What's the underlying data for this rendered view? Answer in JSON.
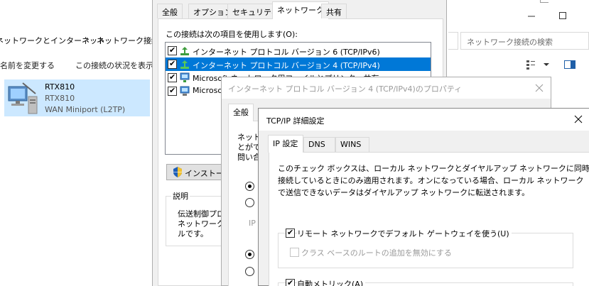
{
  "explorer": {
    "breadcrumb": [
      "ネットワークとインターネット",
      "ネットワーク接続"
    ],
    "search_placeholder": "ネットワーク接続の検索",
    "commands": [
      "名前を変更する",
      "この接続の状況を表示"
    ],
    "connection": {
      "name": "RTX810",
      "line2": "RTX810",
      "line3": "WAN Miniport (L2TP)"
    }
  },
  "adapter_dialog": {
    "tabs": [
      "全般",
      "オプション",
      "セキュリティ",
      "ネットワーク",
      "共有"
    ],
    "active_tab": "ネットワーク",
    "items_label": "この接続は次の項目を使用します(O):",
    "items": [
      {
        "label": "インターネット プロトコル バージョン 6 (TCP/IPv6)",
        "checked": true,
        "selected": false,
        "icon": "protocol-icon"
      },
      {
        "label": "インターネット プロトコル バージョン 4 (TCP/IPv4)",
        "checked": true,
        "selected": true,
        "icon": "protocol-icon"
      },
      {
        "label": "Microsoft ネットワーク用ファイルとプリンター共有",
        "checked": true,
        "selected": false,
        "icon": "network-service-icon"
      },
      {
        "label": "Microsoft",
        "checked": true,
        "selected": false,
        "icon": "network-client-icon"
      }
    ],
    "install_button": "インストール",
    "description_label": "説明",
    "description_text": [
      "伝送制御プロ",
      "ネットワーク間",
      "ルです。"
    ]
  },
  "ipv4_dialog": {
    "title": "インターネット プロトコル バージョン 4 (TCP/IPv4)のプロパティ",
    "tab": "全般",
    "text_fragments": [
      "ネットワ",
      "とができ",
      "問い合"
    ],
    "radio_fragment": "IP"
  },
  "advanced_dialog": {
    "title": "TCP/IP 詳細設定",
    "tabs": [
      "IP 設定",
      "DNS",
      "WINS"
    ],
    "active_tab": "IP 設定",
    "description": [
      "このチェック ボックスは、ローカル ネットワークとダイヤルアップ ネットワークに同時に",
      "接続しているときにのみ適用されます。オンになっている場合、ローカル ネットワーク",
      "で送信できないデータはダイヤルアップ ネットワークに転送されます。"
    ],
    "use_default_gateway": {
      "label": "リモート ネットワークでデフォルト ゲートウェイを使う(U)",
      "checked": true
    },
    "disable_class_route": {
      "label": "クラス ベースのルートの追加を無効にする",
      "checked": false,
      "disabled": true
    },
    "auto_metric": {
      "label": "自動メトリック(A)",
      "checked": true
    }
  }
}
